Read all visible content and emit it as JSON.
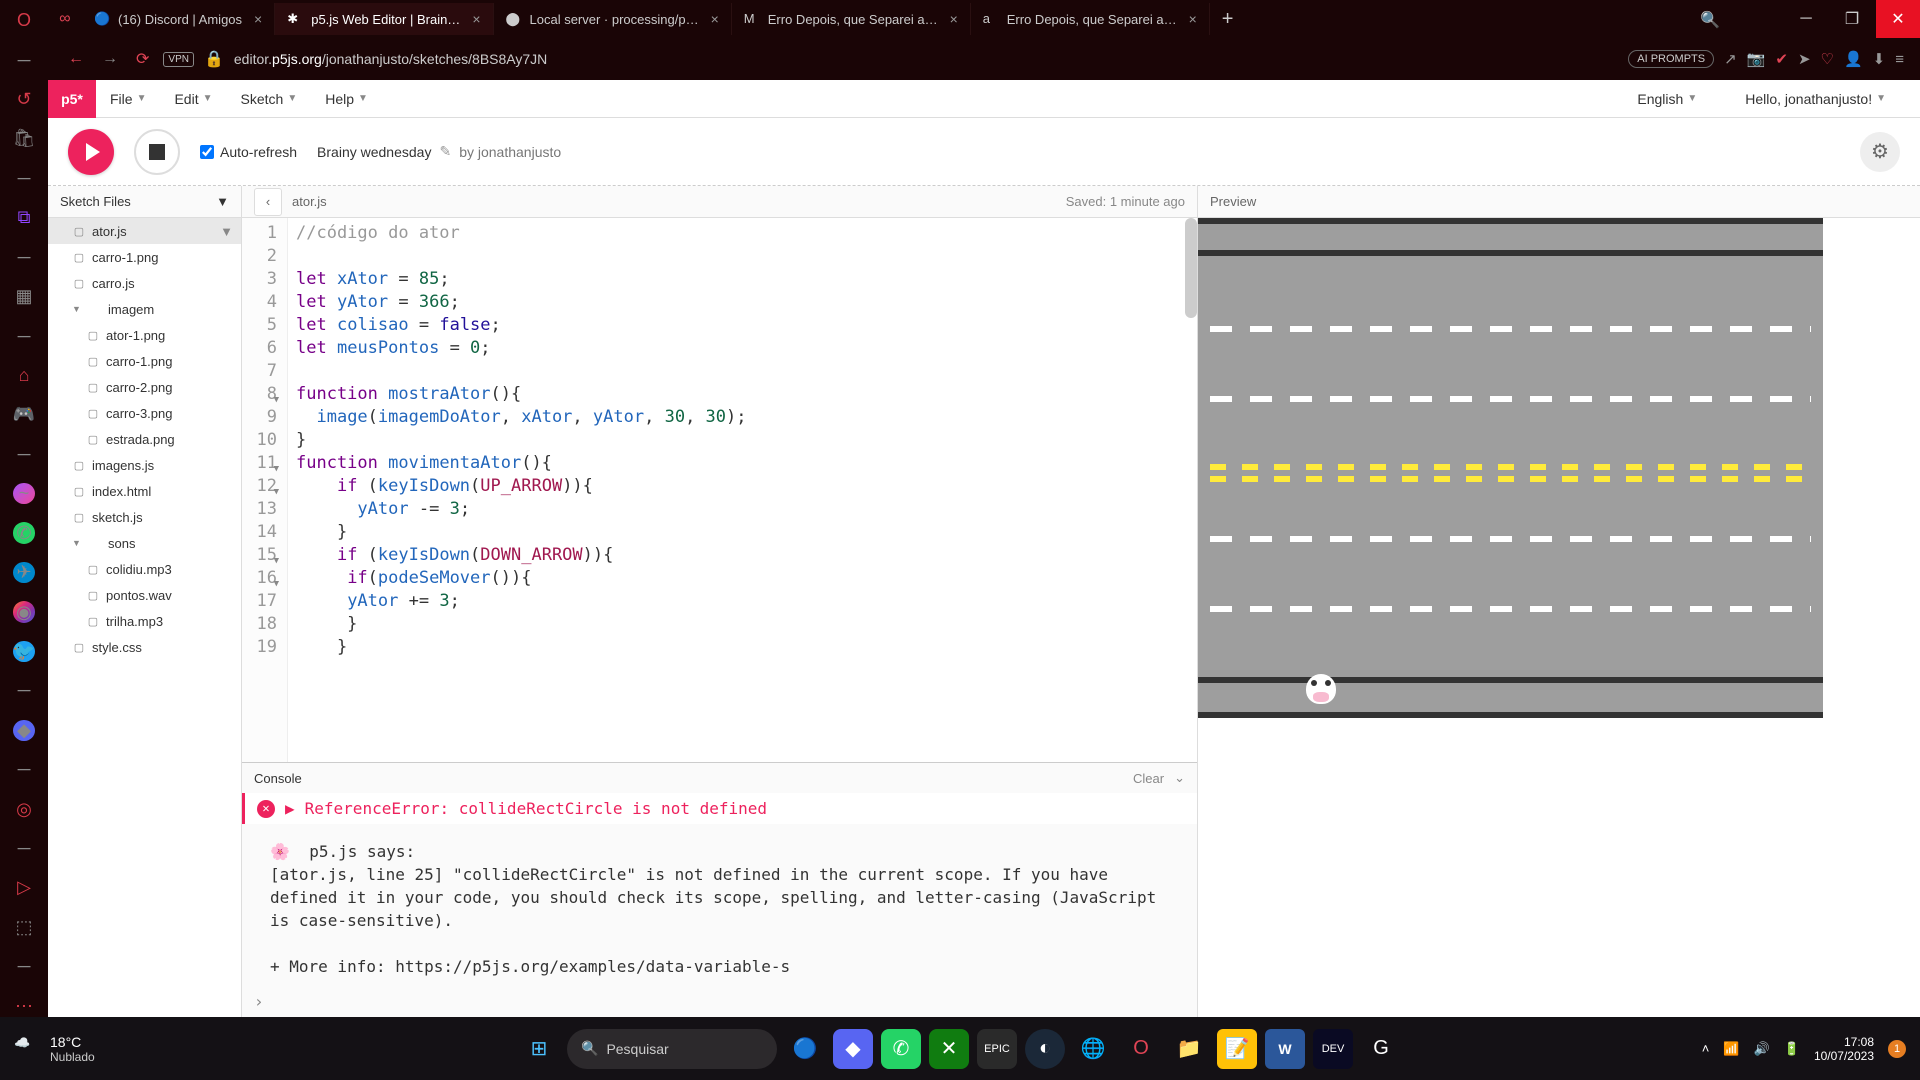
{
  "browser": {
    "tabs": [
      {
        "title": "(16) Discord | Amigos",
        "fav": "🔵"
      },
      {
        "title": "p5.js Web Editor | Brain…",
        "fav": "✱",
        "active": true
      },
      {
        "title": "Local server · processing/p…",
        "fav": "⬤"
      },
      {
        "title": "Erro Depois, que Separei a…",
        "fav": "M"
      },
      {
        "title": "Erro Depois, que Separei a…",
        "fav": "a"
      }
    ],
    "url_prefix": "editor.",
    "url_domain": "p5js.org",
    "url_path": "/jonathanjusto/sketches/8BS8Ay7JN",
    "ai_prompts": "AI PROMPTS"
  },
  "p5": {
    "menus": [
      "File",
      "Edit",
      "Sketch",
      "Help"
    ],
    "lang": "English",
    "greeting": "Hello, jonathanjusto!",
    "auto_refresh": "Auto-refresh",
    "sketch_name": "Brainy wednesday",
    "by": "by jonathanjusto",
    "files_header": "Sketch Files",
    "files": [
      {
        "name": "ator.js",
        "t": "file",
        "active": true
      },
      {
        "name": "carro-1.png",
        "t": "file"
      },
      {
        "name": "carro.js",
        "t": "file"
      },
      {
        "name": "imagem",
        "t": "folder-open"
      },
      {
        "name": "ator-1.png",
        "t": "file",
        "nested": true
      },
      {
        "name": "carro-1.png",
        "t": "file",
        "nested": true
      },
      {
        "name": "carro-2.png",
        "t": "file",
        "nested": true
      },
      {
        "name": "carro-3.png",
        "t": "file",
        "nested": true
      },
      {
        "name": "estrada.png",
        "t": "file",
        "nested": true
      },
      {
        "name": "imagens.js",
        "t": "file"
      },
      {
        "name": "index.html",
        "t": "file"
      },
      {
        "name": "sketch.js",
        "t": "file"
      },
      {
        "name": "sons",
        "t": "folder-open"
      },
      {
        "name": "colidiu.mp3",
        "t": "file",
        "nested": true
      },
      {
        "name": "pontos.wav",
        "t": "file",
        "nested": true
      },
      {
        "name": "trilha.mp3",
        "t": "file",
        "nested": true
      },
      {
        "name": "style.css",
        "t": "file"
      }
    ],
    "editor_file": "ator.js",
    "saved": "Saved: 1 minute ago",
    "preview_label": "Preview",
    "code": [
      {
        "n": 1,
        "html": "<span class='k-comment'>//código do ator</span>"
      },
      {
        "n": 2,
        "html": ""
      },
      {
        "n": 3,
        "html": "<span class='k-keyword'>let</span> <span class='k-var'>xAtor</span> = <span class='k-num'>85</span>;"
      },
      {
        "n": 4,
        "html": "<span class='k-keyword'>let</span> <span class='k-var'>yAtor</span> = <span class='k-num'>366</span>;"
      },
      {
        "n": 5,
        "html": "<span class='k-keyword'>let</span> <span class='k-var'>colisao</span> = <span class='k-bool'>false</span>;"
      },
      {
        "n": 6,
        "html": "<span class='k-keyword'>let</span> <span class='k-var'>meusPontos</span> = <span class='k-num'>0</span>;"
      },
      {
        "n": 7,
        "html": ""
      },
      {
        "n": 8,
        "html": "<span class='k-keyword'>function</span> <span class='k-func'>mostraAtor</span>(){",
        "fold": true
      },
      {
        "n": 9,
        "html": "  <span class='k-func'>image</span>(<span class='k-var'>imagemDoAtor</span>, <span class='k-var'>xAtor</span>, <span class='k-var'>yAtor</span>, <span class='k-num'>30</span>, <span class='k-num'>30</span>);"
      },
      {
        "n": 10,
        "html": "}"
      },
      {
        "n": 11,
        "html": "<span class='k-keyword'>function</span> <span class='k-func'>movimentaAtor</span>(){",
        "fold": true
      },
      {
        "n": 12,
        "html": "    <span class='k-keyword'>if</span> (<span class='k-func'>keyIsDown</span>(<span class='k-const'>UP_ARROW</span>)){",
        "fold": true
      },
      {
        "n": 13,
        "html": "      <span class='k-var'>yAtor</span> -= <span class='k-num'>3</span>;"
      },
      {
        "n": 14,
        "html": "    }"
      },
      {
        "n": 15,
        "html": "    <span class='k-keyword'>if</span> (<span class='k-func'>keyIsDown</span>(<span class='k-const'>DOWN_ARROW</span>)){",
        "fold": true
      },
      {
        "n": 16,
        "html": "     <span class='k-keyword'>if</span>(<span class='k-func'>podeSeMover</span>()){",
        "fold": true
      },
      {
        "n": 17,
        "html": "     <span class='k-var'>yAtor</span> += <span class='k-num'>3</span>;"
      },
      {
        "n": 18,
        "html": "     }"
      },
      {
        "n": 19,
        "html": "    }"
      }
    ],
    "console": {
      "label": "Console",
      "clear": "Clear",
      "error": "ReferenceError: collideRectCircle is not defined",
      "message": "🌸  p5.js says:\n[ator.js, line 25] \"collideRectCircle\" is not defined in the current scope. If you have defined it in your code, you should check its scope, spelling, and letter-casing (JavaScript is case-sensitive).\n\n+ More info: https://p5js.org/examples/data-variable-s"
    }
  },
  "taskbar": {
    "temp": "18°C",
    "cond": "Nublado",
    "search": "Pesquisar",
    "time": "17:08",
    "date": "10/07/2023",
    "notif_count": "1"
  }
}
